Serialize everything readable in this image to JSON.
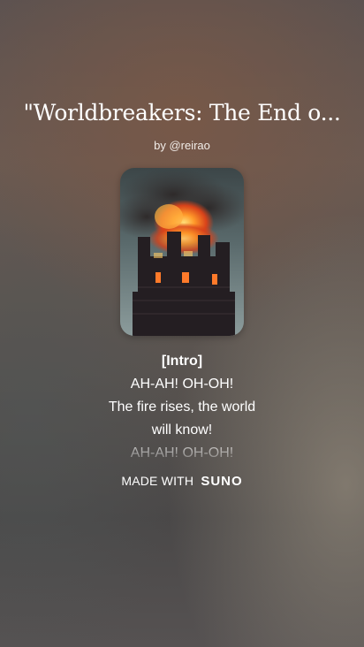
{
  "song": {
    "title": "\"Worldbreakers: The End o...",
    "byline": "by @reirao",
    "cover_icon": "burning-tower-artwork"
  },
  "lyrics": {
    "section": "[Intro]",
    "lines": [
      "AH-AH! OH-OH!",
      "The fire rises, the world",
      "will know!",
      "AH-AH! OH-OH!"
    ]
  },
  "footer": {
    "made_with": "MADE WITH",
    "brand": "SUNO"
  }
}
